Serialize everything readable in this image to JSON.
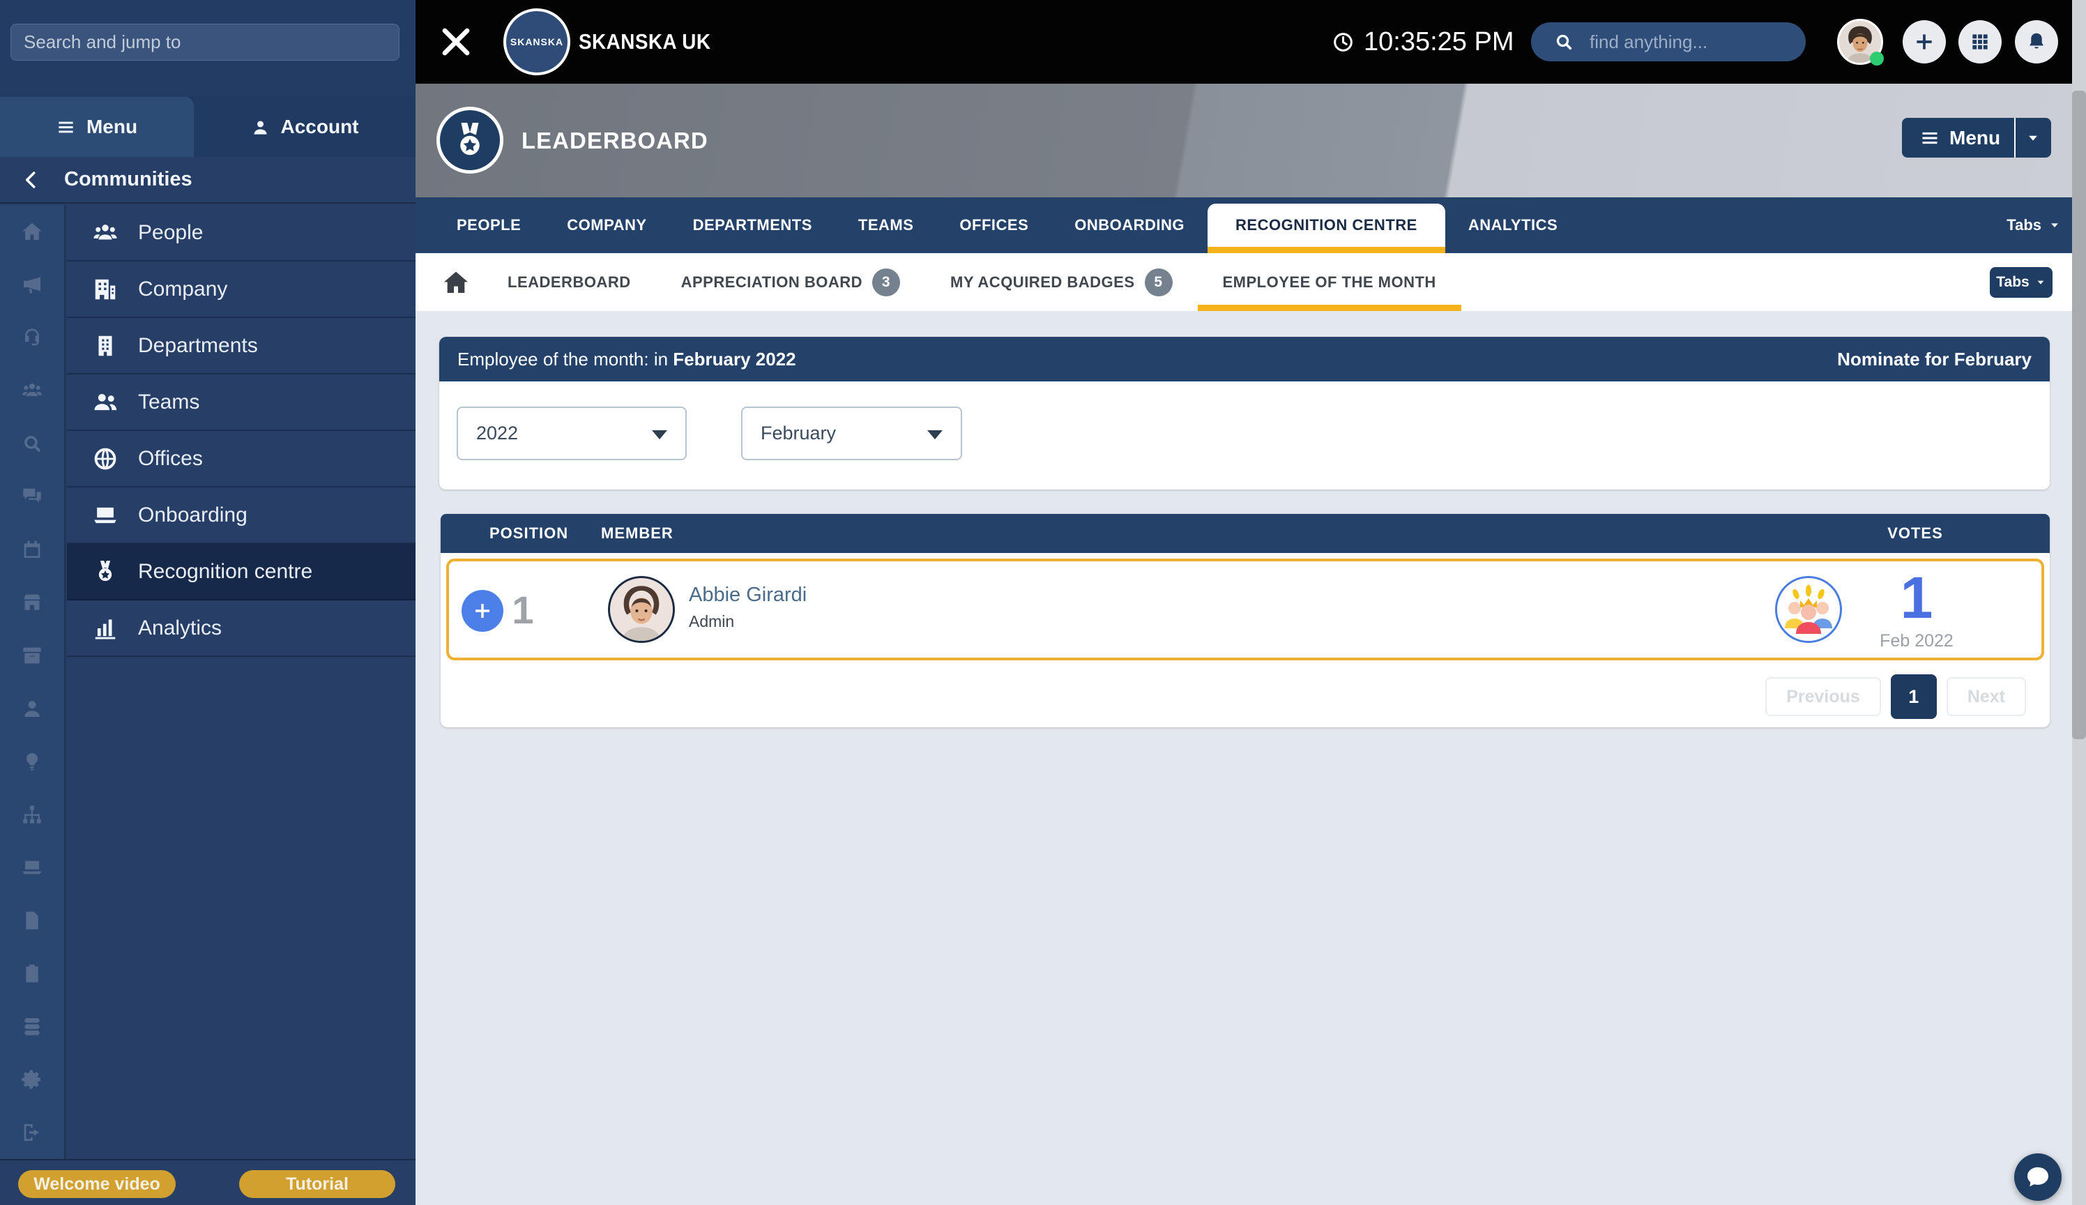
{
  "topbar": {
    "brand": "SKANSKA UK",
    "logo_text": "SKANSKA",
    "time": "10:35:25 PM",
    "search_placeholder": "find anything..."
  },
  "sidebar": {
    "search_placeholder": "Search and jump to",
    "tabs": {
      "menu": "Menu",
      "account": "Account"
    },
    "section_title": "Communities",
    "items": [
      {
        "label": "People",
        "icon": "people3"
      },
      {
        "label": "Company",
        "icon": "company"
      },
      {
        "label": "Departments",
        "icon": "building"
      },
      {
        "label": "Teams",
        "icon": "teams"
      },
      {
        "label": "Offices",
        "icon": "globe"
      },
      {
        "label": "Onboarding",
        "icon": "laptop"
      },
      {
        "label": "Recognition centre",
        "icon": "medal"
      },
      {
        "label": "Analytics",
        "icon": "chart"
      }
    ],
    "rail_icons": [
      "home",
      "megaphone",
      "headset",
      "people3",
      "search",
      "chat",
      "calendar",
      "store",
      "box",
      "user",
      "bulb",
      "sitemap",
      "laptop",
      "file",
      "clipboard",
      "database",
      "gear",
      "signout"
    ],
    "footer_buttons": {
      "welcome": "Welcome video",
      "tutorial": "Tutorial"
    }
  },
  "page_header": {
    "title": "LEADERBOARD",
    "menu_label": "Menu"
  },
  "main_tabs": {
    "items": [
      {
        "label": "PEOPLE"
      },
      {
        "label": "COMPANY"
      },
      {
        "label": "DEPARTMENTS"
      },
      {
        "label": "TEAMS"
      },
      {
        "label": "OFFICES"
      },
      {
        "label": "ONBOARDING"
      },
      {
        "label": "RECOGNITION CENTRE"
      },
      {
        "label": "ANALYTICS"
      }
    ],
    "tabs_button": "Tabs"
  },
  "sub_tabs": {
    "items": [
      {
        "label": "LEADERBOARD"
      },
      {
        "label": "APPRECIATION BOARD",
        "badge": "3"
      },
      {
        "label": "MY ACQUIRED BADGES",
        "badge": "5"
      },
      {
        "label": "EMPLOYEE OF THE MONTH"
      }
    ],
    "tabs_button": "Tabs"
  },
  "eotm": {
    "title_prefix": "Employee of the month: in ",
    "title_period": "February 2022",
    "nominate_label": "Nominate for February",
    "year_value": "2022",
    "month_value": "February"
  },
  "table": {
    "headers": {
      "position": "POSITION",
      "member": "MEMBER",
      "votes": "VOTES"
    },
    "rows": [
      {
        "position": "1",
        "name": "Abbie Girardi",
        "role": "Admin",
        "votes": "1",
        "votes_period": "Feb 2022"
      }
    ]
  },
  "pagination": {
    "previous": "Previous",
    "page": "1",
    "next": "Next"
  },
  "colors": {
    "navy": "#24416A",
    "navy-dark": "#1F3C63",
    "amber": "#F5B21B",
    "row-outline": "#EFB133",
    "gold": "#D2A02F",
    "vote-blue": "#4A6FE0",
    "plus-blue": "#4D7FE8",
    "badge-gray": "#75818F",
    "green": "#2ECC71"
  }
}
